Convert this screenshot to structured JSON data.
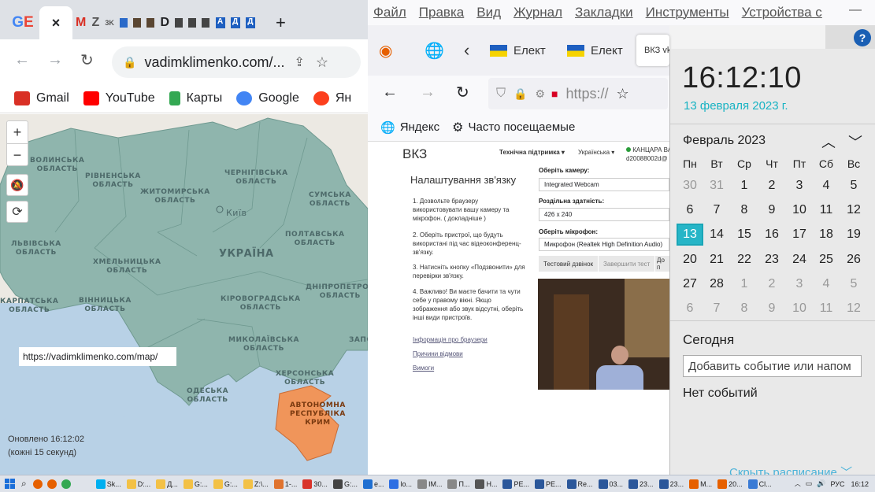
{
  "chrome": {
    "tab_labels": "GE M  Z  D  Д Д",
    "close_label": "×",
    "new_tab_label": "+",
    "url": "vadimklimenko.com/...",
    "bookmarks": [
      {
        "label": "Gmail",
        "color": "#d93025"
      },
      {
        "label": "YouTube",
        "color": "#ff0000"
      },
      {
        "label": "Карты",
        "color": "#34a853"
      },
      {
        "label": "Google",
        "color": "#4285f4"
      },
      {
        "label": "Ян",
        "color": "#fc3f1d"
      }
    ]
  },
  "map": {
    "regions": [
      "ВОЛИНСЬКА ОБЛАСТЬ",
      "РІВНЕНСЬКА ОБЛАСТЬ",
      "ЖИТОМИРСЬКА ОБЛАСТЬ",
      "ЧЕРНІГІВСЬКА ОБЛАСТЬ",
      "СУМСЬКА ОБЛАСТЬ",
      "Київ",
      "ЛЬВІВСЬКА ОБЛАСТЬ",
      "ХМЕЛЬНИЦЬКА ОБЛАСТЬ",
      "УКРАЇНА",
      "ПОЛТАВСЬКА ОБЛАСТЬ",
      "КАРПАТСЬКА ОБЛАСТЬ",
      "ВІННИЦЬКА ОБЛАСТЬ",
      "КІРОВОГРАДСЬКА ОБЛАСТЬ",
      "ДНІПРОПЕТРОВ ОБЛАСТЬ",
      "МИКОЛАЇВСЬКА ОБЛАСТЬ",
      "ЗАПО",
      "ХЕРСОНСЬКА ОБЛАСТЬ",
      "ОДЕСЬКА ОБЛАСТЬ",
      "АВТОНОМНА РЕСПУБЛІКА КРИМ"
    ],
    "url_note": "https://vadimklimenko.com/map/",
    "updated": "Оновлено 16:12:02",
    "interval": "(кожні 15 секунд)",
    "zoom_in": "+",
    "zoom_out": "−"
  },
  "firefox": {
    "menu": [
      "Файл",
      "Правка",
      "Вид",
      "Журнал",
      "Закладки",
      "Инструменты",
      "Устройства с"
    ],
    "tabs": [
      "Елект",
      "Елект",
      "ВКЗ  vk"
    ],
    "url": "https://",
    "bookmarks": [
      "Яндекс",
      "Часто посещаемые"
    ]
  },
  "vkz": {
    "logo": "ВКЗ",
    "support": "Технічна підтримка ▾",
    "lang": "Українська ▾",
    "user": "КАНЦАРА ВАЛ",
    "user_id": "d20088002d@",
    "title": "Налаштування зв'язку",
    "steps": [
      "1. Дозвольте браузеру використовувати вашу камеру та мікрофон. ( докладніше )",
      "2. Оберіть пристрої, що будуть використані під час відеоконференц-зв'язку.",
      "3. Натисніть кнопку «Подзвонити» для перевірки зв'язку.",
      "4. Важливо! Ви маєте бачити та чути себе у правому вікні. Якщо зображення або звук відсутні, оберіть інші види пристроїв."
    ],
    "links": [
      "Інформація про браузери",
      "Причини відмови",
      "Вимоги"
    ],
    "camera_label": "Оберіть камеру:",
    "camera": "Integrated Webcam",
    "res_label": "Роздільна здатність:",
    "res": "426 x 240",
    "mic_label": "Оберіть мікрофон:",
    "mic": "Микрофон (Realtek High Definition Audio)",
    "btn_test": "Тестовий дзвінок",
    "btn_end": "Завершити тест",
    "btn_more": "До п"
  },
  "flyout": {
    "time": "16:12:10",
    "date": "13 февраля 2023 г.",
    "month": "Февраль 2023",
    "dow": [
      "Пн",
      "Вт",
      "Ср",
      "Чт",
      "Пт",
      "Сб",
      "Вс"
    ],
    "weeks": [
      [
        [
          "30",
          1
        ],
        [
          "31",
          1
        ],
        [
          "1",
          0
        ],
        [
          "2",
          0
        ],
        [
          "3",
          0
        ],
        [
          "4",
          0
        ],
        [
          "5",
          0
        ]
      ],
      [
        [
          "6",
          0
        ],
        [
          "7",
          0
        ],
        [
          "8",
          0
        ],
        [
          "9",
          0
        ],
        [
          "10",
          0
        ],
        [
          "11",
          0
        ],
        [
          "12",
          0
        ]
      ],
      [
        [
          "13",
          2
        ],
        [
          "14",
          0
        ],
        [
          "15",
          0
        ],
        [
          "16",
          0
        ],
        [
          "17",
          0
        ],
        [
          "18",
          0
        ],
        [
          "19",
          0
        ]
      ],
      [
        [
          "20",
          0
        ],
        [
          "21",
          0
        ],
        [
          "22",
          0
        ],
        [
          "23",
          0
        ],
        [
          "24",
          0
        ],
        [
          "25",
          0
        ],
        [
          "26",
          0
        ]
      ],
      [
        [
          "27",
          0
        ],
        [
          "28",
          0
        ],
        [
          "1",
          1
        ],
        [
          "2",
          1
        ],
        [
          "3",
          1
        ],
        [
          "4",
          1
        ],
        [
          "5",
          1
        ]
      ],
      [
        [
          "6",
          1
        ],
        [
          "7",
          1
        ],
        [
          "8",
          1
        ],
        [
          "9",
          1
        ],
        [
          "10",
          1
        ],
        [
          "11",
          1
        ],
        [
          "12",
          1
        ]
      ]
    ],
    "today": "Сегодня",
    "event_placeholder": "Добавить событие или напом",
    "no_events": "Нет событий",
    "hide": "Скрыть расписание"
  },
  "taskbar": {
    "items": [
      {
        "label": "Sk...",
        "color": "#00aff0"
      },
      {
        "label": "D:...",
        "color": "#f3c146"
      },
      {
        "label": "Д...",
        "color": "#f3c146"
      },
      {
        "label": "G:...",
        "color": "#f3c146"
      },
      {
        "label": "G:...",
        "color": "#f3c146"
      },
      {
        "label": "Z:\\...",
        "color": "#f3c146"
      },
      {
        "label": "1-...",
        "color": "#e0732e"
      },
      {
        "label": "30...",
        "color": "#d9342b"
      },
      {
        "label": "G:...",
        "color": "#444"
      },
      {
        "label": "e...",
        "color": "#1f6fd1"
      },
      {
        "label": "lo...",
        "color": "#2e6fe3"
      },
      {
        "label": "IM...",
        "color": "#888"
      },
      {
        "label": "П...",
        "color": "#888"
      },
      {
        "label": "Н...",
        "color": "#555"
      },
      {
        "label": "РЕ...",
        "color": "#2b579a"
      },
      {
        "label": "РЕ...",
        "color": "#2b579a"
      },
      {
        "label": "Re...",
        "color": "#2b579a"
      },
      {
        "label": "03...",
        "color": "#2b579a"
      },
      {
        "label": "23...",
        "color": "#2b579a"
      },
      {
        "label": "23...",
        "color": "#2b579a"
      },
      {
        "label": "М...",
        "color": "#e66000"
      },
      {
        "label": "20...",
        "color": "#e66000"
      },
      {
        "label": "Cl...",
        "color": "#3a7bd5"
      }
    ],
    "lang": "РУС",
    "time": "16:12"
  }
}
